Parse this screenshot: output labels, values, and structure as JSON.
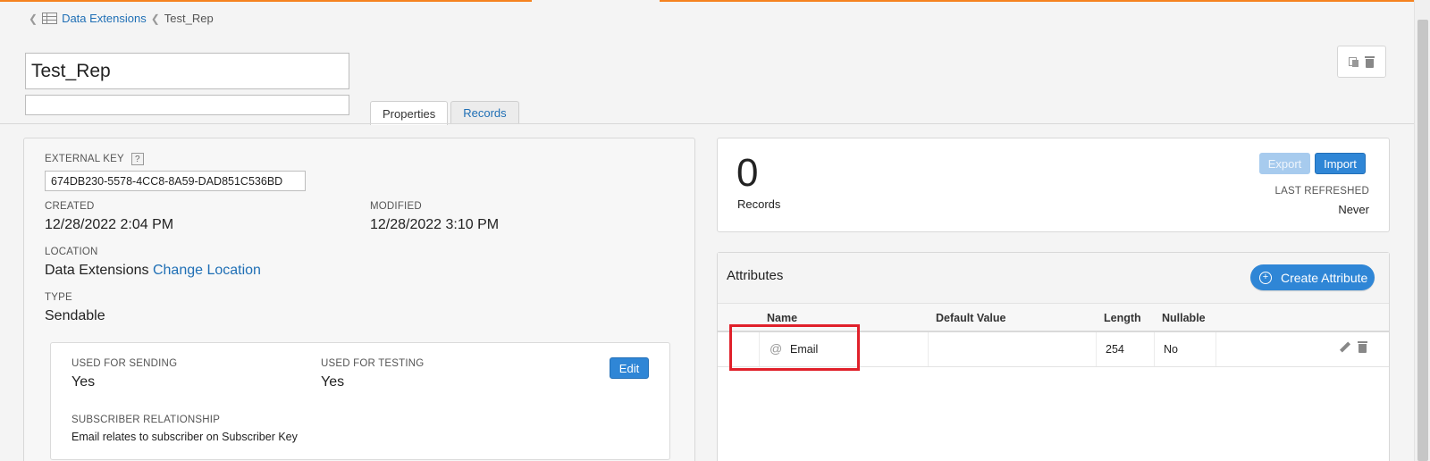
{
  "breadcrumb": {
    "parent_label": "Data Extensions",
    "current_label": "Test_Rep"
  },
  "name_field": {
    "value": "Test_Rep"
  },
  "description_field": {
    "value": ""
  },
  "tabs": [
    {
      "label": "Properties",
      "active": true
    },
    {
      "label": "Records",
      "active": false
    }
  ],
  "properties": {
    "external_key_label": "EXTERNAL KEY",
    "help_symbol": "?",
    "external_key_value": "674DB230-5578-4CC8-8A59-DAD851C536BD",
    "created_label": "CREATED",
    "created_value": "12/28/2022 2:04 PM",
    "modified_label": "MODIFIED",
    "modified_value": "12/28/2022 3:10 PM",
    "location_label": "LOCATION",
    "location_value": "Data Extensions",
    "change_location_label": "Change Location",
    "type_label": "TYPE",
    "type_value": "Sendable",
    "sending_label": "USED FOR SENDING",
    "sending_value": "Yes",
    "testing_label": "USED FOR TESTING",
    "testing_value": "Yes",
    "edit_label": "Edit",
    "relationship_label": "SUBSCRIBER RELATIONSHIP",
    "relationship_value": "Email relates to subscriber on Subscriber Key"
  },
  "records_summary": {
    "count": "0",
    "count_label": "Records",
    "export_label": "Export",
    "import_label": "Import",
    "last_refreshed_label": "LAST REFRESHED",
    "last_refreshed_value": "Never"
  },
  "attributes": {
    "title": "Attributes",
    "create_label": "Create Attribute",
    "plus_symbol": "+",
    "columns": [
      "Name",
      "Default Value",
      "Length",
      "Nullable"
    ],
    "rows": [
      {
        "icon": "@",
        "name": "Email",
        "default_value": "",
        "length": "254",
        "nullable": "No"
      }
    ]
  },
  "colors": {
    "accent": "#f5821f",
    "link": "#1f6fb5",
    "button": "#2f86d6",
    "highlight": "#e0202a"
  }
}
